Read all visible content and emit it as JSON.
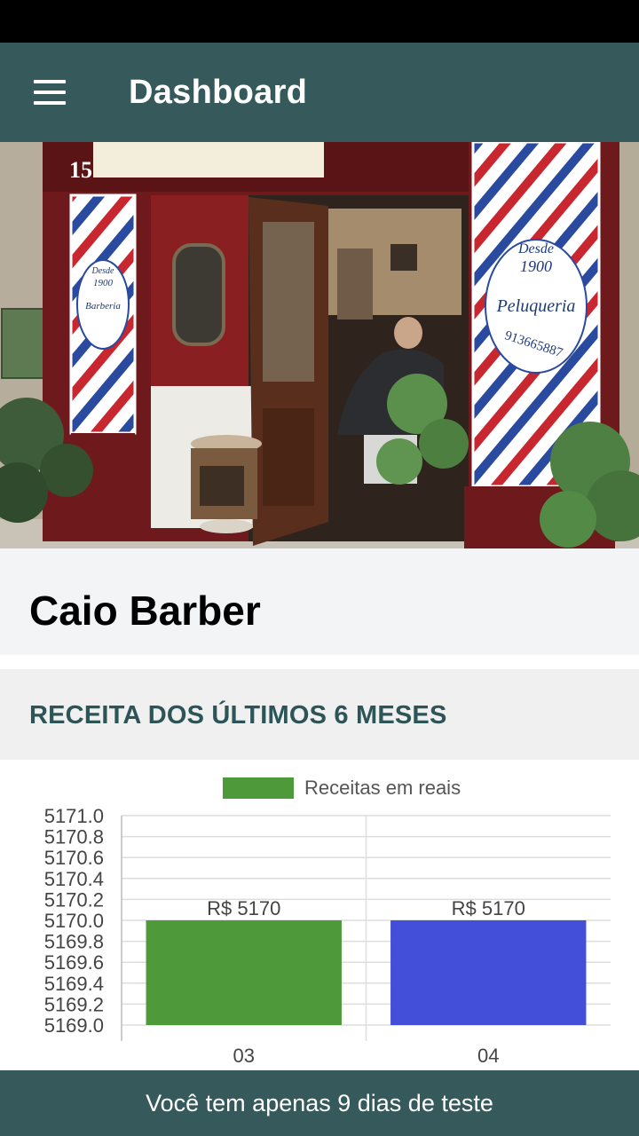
{
  "app_bar": {
    "title": "Dashboard",
    "menu_icon": "hamburger-menu-icon"
  },
  "hero_image": {
    "sign_number": "15",
    "right_panel_lines": [
      "Desde",
      "1900",
      "Peluqueria",
      "913665887"
    ],
    "left_panel_lines": [
      "Desde",
      "1900",
      "Barberia"
    ]
  },
  "shop": {
    "name": "Caio Barber"
  },
  "section": {
    "title": "RECEITA DOS ÚLTIMOS 6 MESES"
  },
  "colors": {
    "primary": "#365a5c",
    "bar_1": "#4e9a3b",
    "bar_2": "#434fd9",
    "section_text": "#2d5457"
  },
  "chart_data": {
    "type": "bar",
    "legend": {
      "label": "Receitas em reais",
      "position": "top-center"
    },
    "categories": [
      "03",
      "04"
    ],
    "values": [
      5170,
      5170
    ],
    "value_labels": [
      "R$ 5170",
      "R$ 5170"
    ],
    "bar_colors": [
      "#4e9a3b",
      "#434fd9"
    ],
    "ylim": [
      5169.0,
      5171.0
    ],
    "yticks": [
      "5171.0",
      "5170.8",
      "5170.6",
      "5170.4",
      "5170.2",
      "5170.0",
      "5169.8",
      "5169.6",
      "5169.4",
      "5169.2",
      "5169.0"
    ],
    "grid": true
  },
  "banner": {
    "text": "Você tem apenas 9 dias de teste"
  }
}
